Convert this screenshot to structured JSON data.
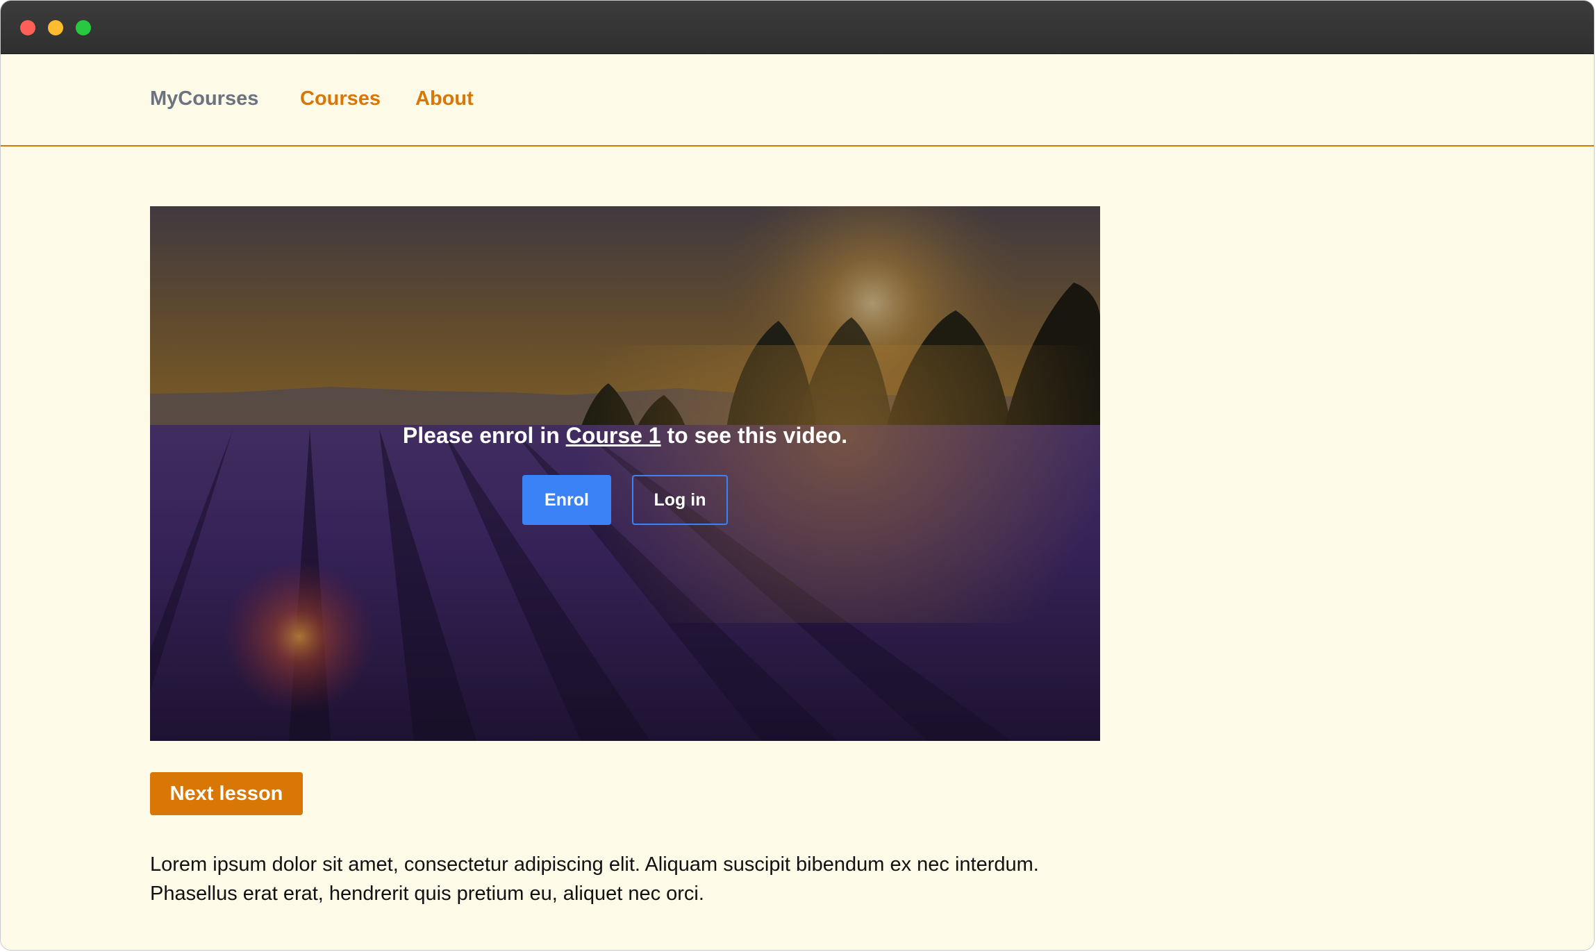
{
  "nav": {
    "brand": "MyCourses",
    "links": [
      "Courses",
      "About"
    ]
  },
  "video": {
    "message_before": "Please enrol in",
    "course_link": "Course 1",
    "message_after": "to see this video.",
    "enrol_label": "Enrol",
    "login_label": "Log in"
  },
  "next_lesson_label": "Next lesson",
  "body_text": {
    "line1": "Lorem ipsum dolor sit amet, consectetur adipiscing elit. Aliquam suscipit bibendum ex nec interdum.",
    "line2": "Phasellus erat erat, hendrerit quis pretium eu, aliquet nec orci."
  },
  "colors": {
    "accent": "#d97706",
    "primary": "#3b82f6",
    "background": "#fefae8",
    "brand_text": "#6b7280"
  }
}
